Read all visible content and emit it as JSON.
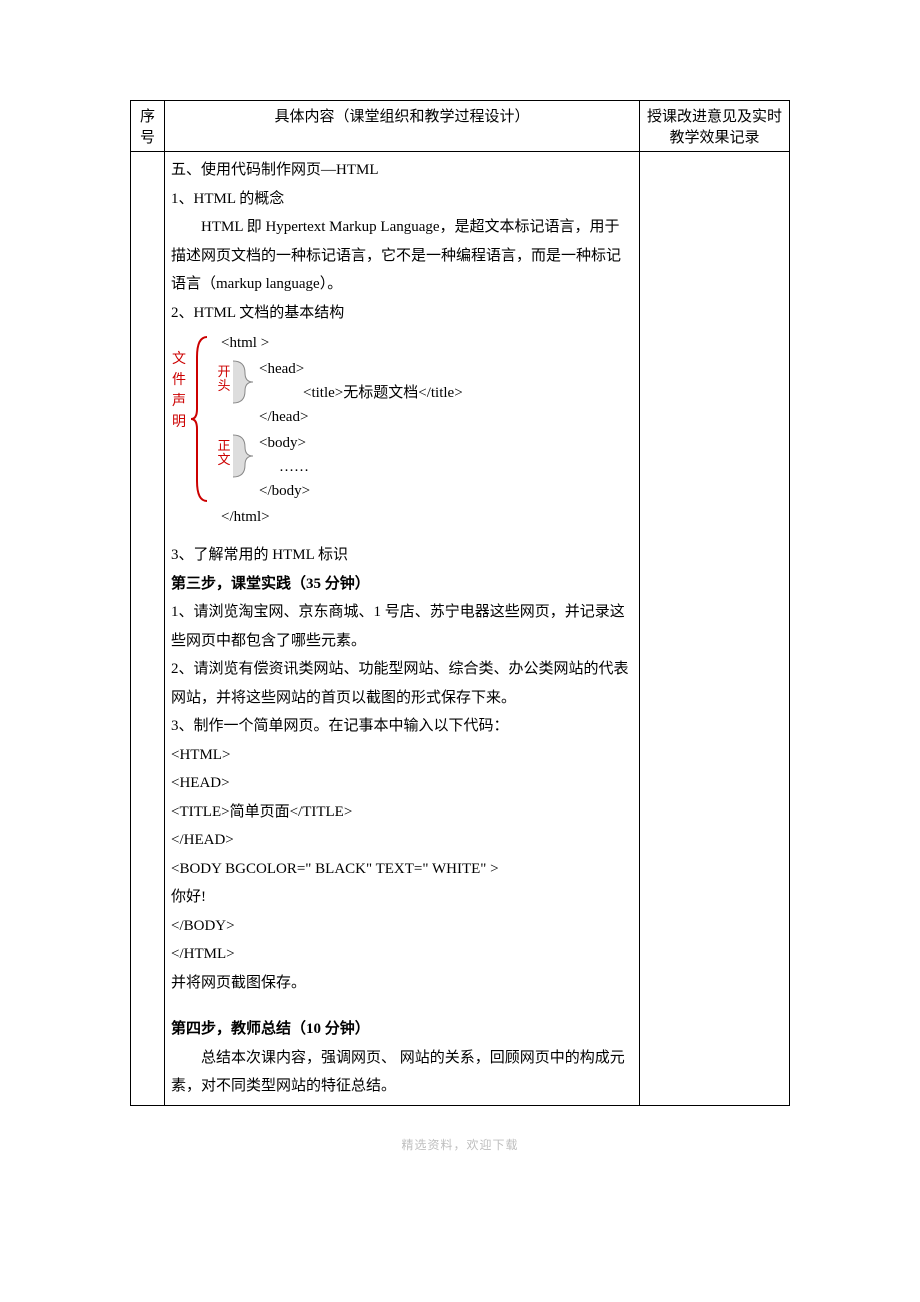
{
  "header": {
    "col_seq": "序号",
    "col_content": "具体内容（课堂组织和教学过程设计）",
    "col_notes": "授课改进意见及实时教学效果记录"
  },
  "content": {
    "section5_title": "五、使用代码制作网页—HTML",
    "item1_title": "1、HTML 的概念",
    "item1_body": "HTML 即 Hypertext Markup Language，是超文本标记语言，用于描述网页文档的一种标记语言，它不是一种编程语言，而是一种标记语言（markup language）。",
    "item2_title": "2、HTML 文档的基本结构",
    "struct": {
      "file_label": "文件声明",
      "html_open": "<html >",
      "head_open": "<head>",
      "title_line": "<title>无标题文档</title>",
      "head_close": "</head>",
      "body_open": "<body>",
      "body_dots": "……",
      "body_close": "</body>",
      "html_close": "</html>",
      "sub_head_label": "开头",
      "sub_body_label": "正文"
    },
    "item3_title": "3、了解常用的 HTML 标识",
    "step3_title": "第三步，课堂实践（35 分钟）",
    "step3_1": "1、请浏览淘宝网、京东商城、1 号店、苏宁电器这些网页，并记录这些网页中都包含了哪些元素。",
    "step3_2": "2、请浏览有偿资讯类网站、功能型网站、综合类、办公类网站的代表网站，并将这些网站的首页以截图的形式保存下来。",
    "step3_3": "3、制作一个简单网页。在记事本中输入以下代码：",
    "code": {
      "l1": "<HTML>",
      "l2": "<HEAD>",
      "l3": "<TITLE>简单页面</TITLE>",
      "l4": "</HEAD>",
      "l5": "<BODY  BGCOLOR=\" BLACK\"  TEXT=\" WHITE\" >",
      "l6": "你好!",
      "l7": "</BODY>",
      "l8": "</HTML>"
    },
    "step3_end": "并将网页截图保存。",
    "step4_title": "第四步，教师总结（10 分钟）",
    "step4_body": "总结本次课内容，强调网页、 网站的关系，回顾网页中的构成元素，对不同类型网站的特征总结。"
  },
  "footer": "精选资料，欢迎下载"
}
